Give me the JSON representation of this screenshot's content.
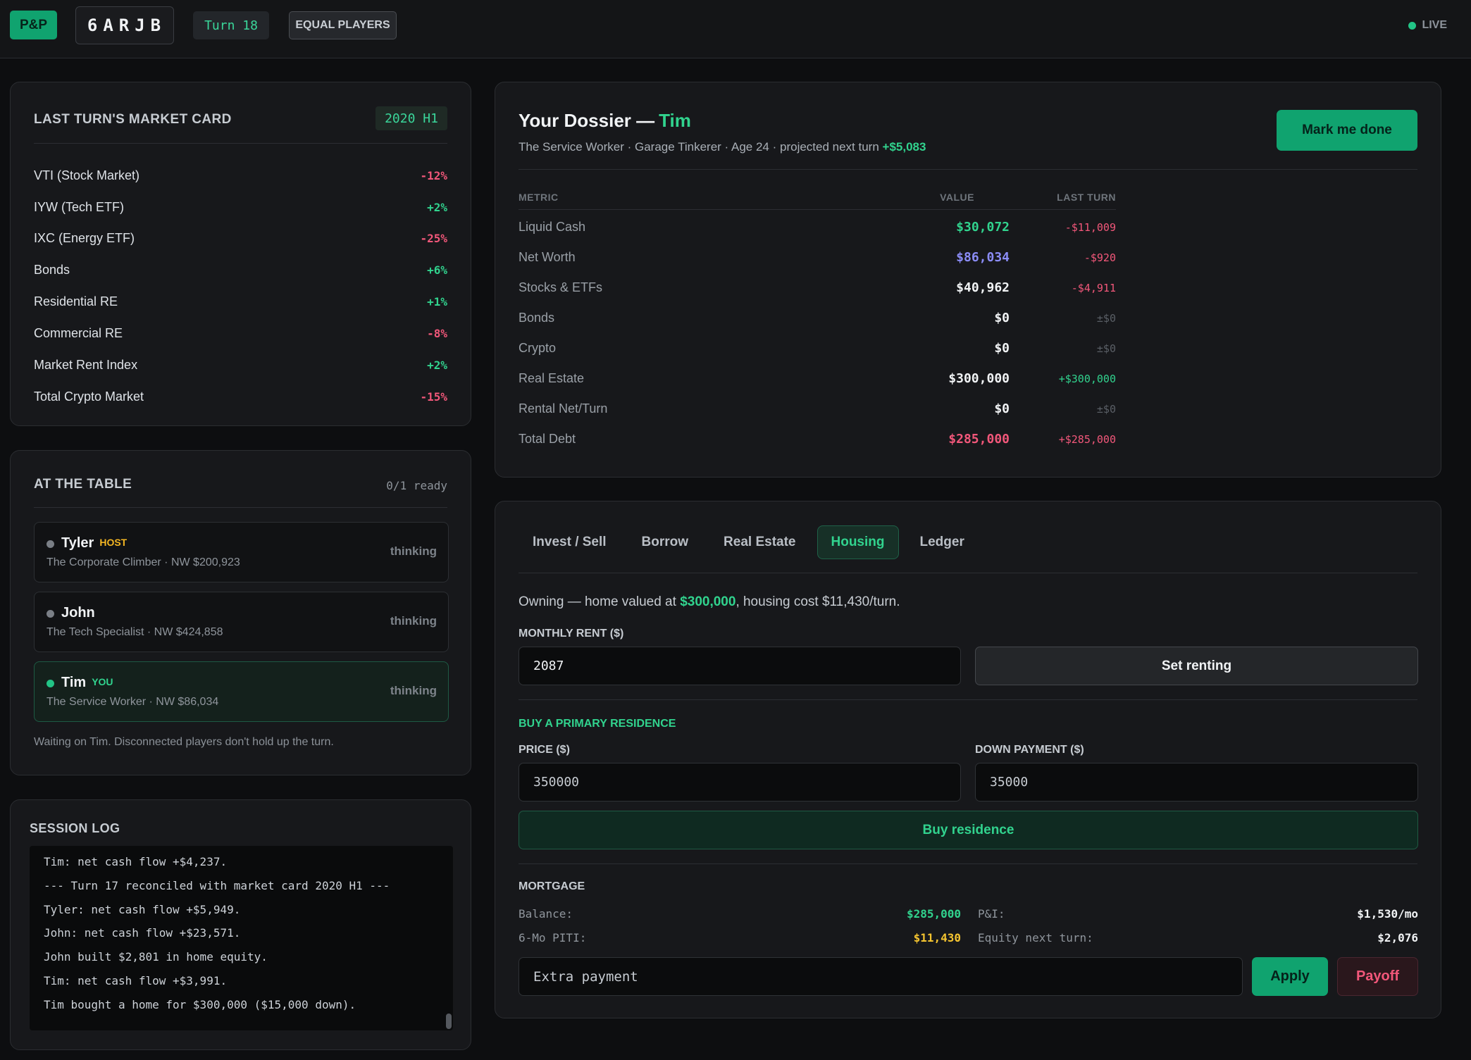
{
  "topbar": {
    "logo": "P&P",
    "room_code": "6ARJB",
    "turn": "Turn 18",
    "mode": "EQUAL PLAYERS",
    "live": "LIVE"
  },
  "market": {
    "title": "LAST TURN'S MARKET CARD",
    "period": "2020 H1",
    "rows": [
      {
        "label": "VTI (Stock Market)",
        "value": "-12%"
      },
      {
        "label": "IYW (Tech ETF)",
        "value": "+2%"
      },
      {
        "label": "IXC (Energy ETF)",
        "value": "-25%"
      },
      {
        "label": "Bonds",
        "value": "+6%"
      },
      {
        "label": "Residential RE",
        "value": "+1%"
      },
      {
        "label": "Commercial RE",
        "value": "-8%"
      },
      {
        "label": "Market Rent Index",
        "value": "+2%"
      },
      {
        "label": "Total Crypto Market",
        "value": "-15%"
      }
    ]
  },
  "table": {
    "title": "AT THE TABLE",
    "ready": "0/1 ready",
    "players": [
      {
        "name": "Tyler",
        "tag": "HOST",
        "sub": "The Corporate Climber · NW $200,923",
        "status": "thinking"
      },
      {
        "name": "John",
        "tag": "",
        "sub": "The Tech Specialist · NW $424,858",
        "status": "thinking"
      },
      {
        "name": "Tim",
        "tag": "YOU",
        "sub": "The Service Worker · NW $86,034",
        "status": "thinking"
      }
    ],
    "waiting": "Waiting on Tim. Disconnected players don't hold up the turn."
  },
  "log": {
    "title": "SESSION LOG",
    "lines": [
      "Tim: net cash flow +$4,237.",
      "--- Turn 17 reconciled with market card 2020 H1 ---",
      "Tyler: net cash flow +$5,949.",
      "John: net cash flow +$23,571.",
      "John built $2,801 in home equity.",
      "Tim: net cash flow +$3,991.",
      "Tim bought a home for $300,000 ($15,000 down)."
    ]
  },
  "dossier": {
    "title": "Your Dossier —",
    "name": "Tim",
    "sub_prefix": "The Service Worker · Garage Tinkerer · Age 24 · projected next turn ",
    "sub_projected": "+$5,083",
    "done_button": "Mark me done",
    "headers": {
      "metric": "METRIC",
      "value": "VALUE",
      "last": "LAST TURN"
    },
    "metrics": [
      {
        "label": "Liquid Cash",
        "value": "$30,072",
        "last": "-$11,009"
      },
      {
        "label": "Net Worth",
        "value": "$86,034",
        "last": "-$920"
      },
      {
        "label": "Stocks & ETFs",
        "value": "$40,962",
        "last": "-$4,911"
      },
      {
        "label": "Bonds",
        "value": "$0",
        "last": "±$0"
      },
      {
        "label": "Crypto",
        "value": "$0",
        "last": "±$0"
      },
      {
        "label": "Real Estate",
        "value": "$300,000",
        "last": "+$300,000"
      },
      {
        "label": "Rental Net/Turn",
        "value": "$0",
        "last": "±$0"
      },
      {
        "label": "Total Debt",
        "value": "$285,000",
        "last": "+$285,000"
      }
    ]
  },
  "actions": {
    "tabs": [
      "Invest / Sell",
      "Borrow",
      "Real Estate",
      "Housing",
      "Ledger"
    ],
    "active_tab": "Housing",
    "owning_prefix": "Owning — home valued at ",
    "owning_value": "$300,000",
    "owning_suffix": ", housing cost $11,430/turn.",
    "rent_label": "MONTHLY RENT ($)",
    "rent_value": "2087",
    "set_renting": "Set renting",
    "buy_title": "BUY A PRIMARY RESIDENCE",
    "price_label": "PRICE ($)",
    "price_value": "350000",
    "down_label": "DOWN PAYMENT ($)",
    "down_value": "35000",
    "buy_button": "Buy residence",
    "mortgage_title": "MORTGAGE",
    "balance_label": "Balance:",
    "balance_value": "$285,000",
    "pi_label": "P&I:",
    "pi_value": "$1,530/mo",
    "piti_label": "6-Mo PITI:",
    "piti_value": "$11,430",
    "equity_label": "Equity next turn:",
    "equity_value": "$2,076",
    "extra_placeholder": "Extra payment",
    "apply": "Apply",
    "payoff": "Payoff"
  },
  "colors": {
    "accent": "#10a36f",
    "positive": "#31d38e",
    "negative": "#f2577a",
    "networth": "#8b8cf6",
    "warning": "#f4c430",
    "host": "#f4b623"
  }
}
